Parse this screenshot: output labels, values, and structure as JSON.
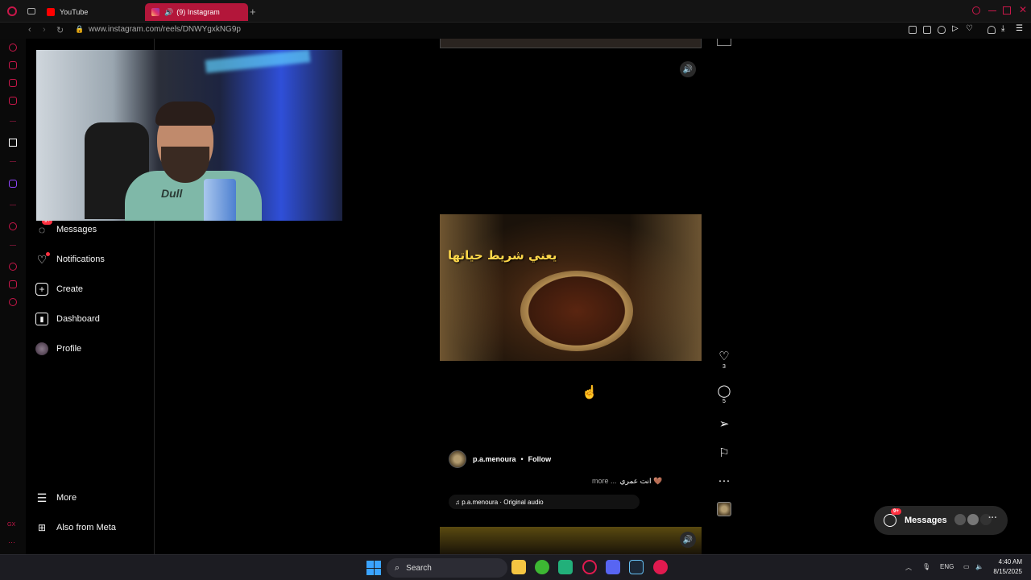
{
  "browser": {
    "tabs": [
      {
        "label": "YouTube",
        "color": "#ff0000"
      },
      {
        "label": "(9) Instagram",
        "color": "#e1306c"
      }
    ],
    "url": "www.instagram.com/reels/DNWYgxkNG9p",
    "accent": "#c9174a"
  },
  "instagram_nav": {
    "messages": {
      "label": "Messages",
      "badge": "9+"
    },
    "notifications": {
      "label": "Notifications"
    },
    "create": {
      "label": "Create"
    },
    "dashboard": {
      "label": "Dashboard"
    },
    "profile": {
      "label": "Profile"
    },
    "more": {
      "label": "More"
    },
    "meta": {
      "label": "Also from Meta"
    }
  },
  "webcam": {
    "shirt_text": "Dull"
  },
  "reel": {
    "video_caption": "يعني شريط حياتها",
    "author": "p.a.menoura",
    "separator": "•",
    "follow_label": "Follow",
    "caption_text": "انت عمري 🤎",
    "more_label": "more ...",
    "audio": "♫ p.a.menoura · Original audio",
    "likes": "3",
    "comments": "5"
  },
  "messages_pill": {
    "label": "Messages",
    "badge": "9+"
  },
  "taskbar": {
    "search_placeholder": "Search",
    "lang": "ENG",
    "time": "4:40 AM",
    "date": "8/15/2025"
  }
}
